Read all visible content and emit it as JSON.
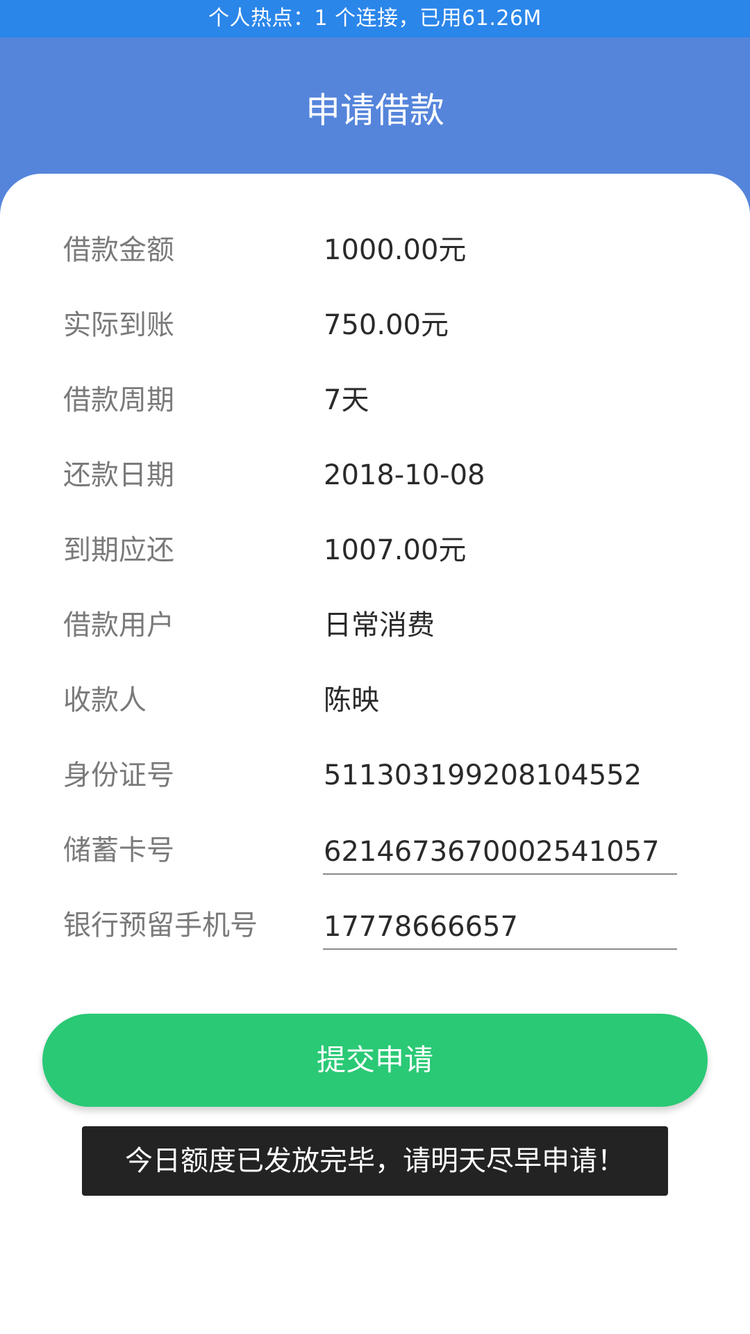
{
  "status_bar": {
    "hotspot_text": "个人热点：1 个连接，已用61.26M"
  },
  "header": {
    "title": "申请借款"
  },
  "form": {
    "rows": [
      {
        "label": "借款金额",
        "value": "1000.00元"
      },
      {
        "label": "实际到账",
        "value": "750.00元"
      },
      {
        "label": "借款周期",
        "value": "7天"
      },
      {
        "label": "还款日期",
        "value": "2018-10-08"
      },
      {
        "label": "到期应还",
        "value": "1007.00元"
      },
      {
        "label": "借款用户",
        "value": "日常消费"
      },
      {
        "label": "收款人",
        "value": "陈映"
      },
      {
        "label": "身份证号",
        "value": "511303199208104552"
      }
    ],
    "debit_card": {
      "label": "储蓄卡号",
      "value": "6214673670002541057"
    },
    "bank_phone": {
      "label": "银行预留手机号",
      "value": "17778666657"
    }
  },
  "actions": {
    "submit_label": "提交申请"
  },
  "toast": {
    "message": "今日额度已发放完毕，请明天尽早申请！"
  },
  "colors": {
    "status_bar": "#2b86ea",
    "header": "#5585db",
    "submit_button": "#2ac975",
    "toast_bg": "#232323"
  }
}
